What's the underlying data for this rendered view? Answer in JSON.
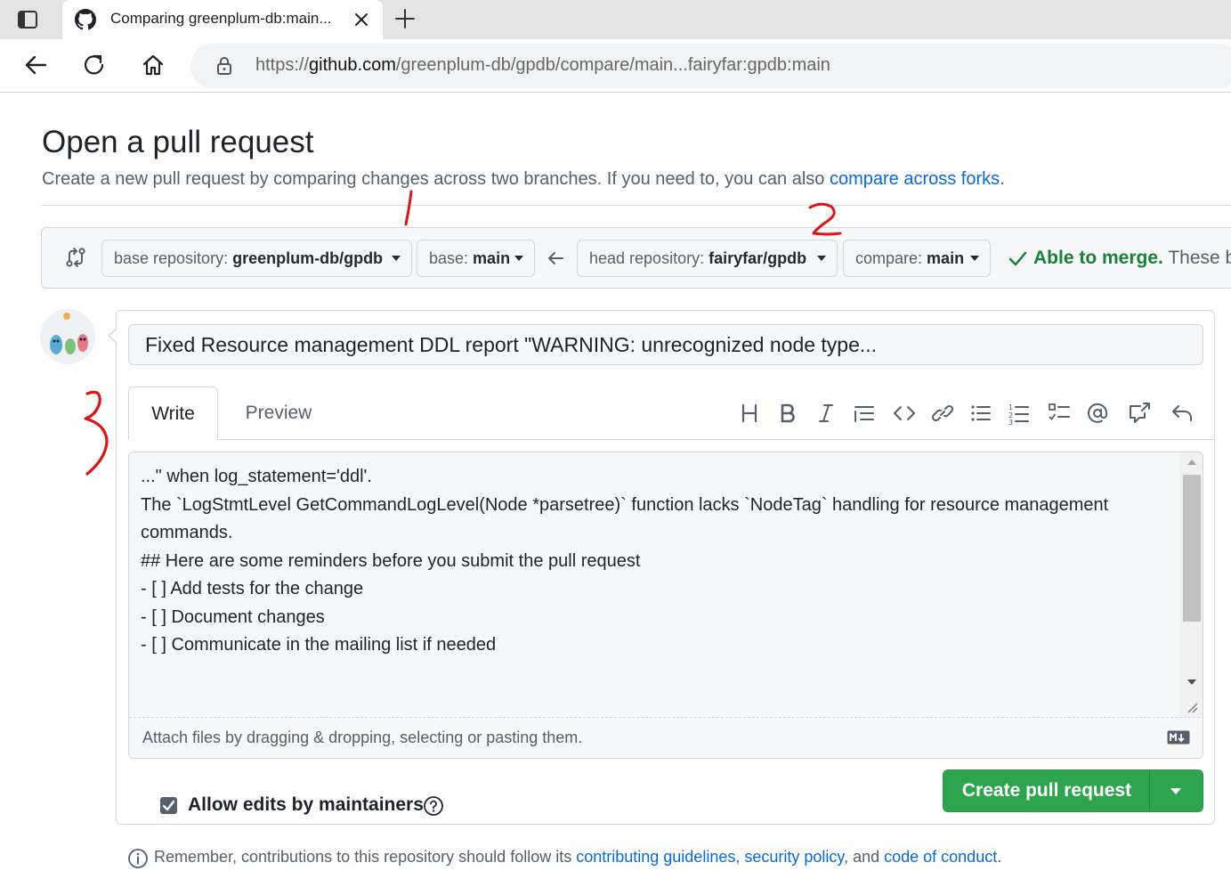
{
  "browser": {
    "tab_title": "Comparing greenplum-db:main...",
    "url_scheme": "https://",
    "url_host": "github.com",
    "url_path": "/greenplum-db/gpdb/compare/main...fairyfar:gpdb:main",
    "icons": [
      "sidebar-icon",
      "github-icon",
      "close-icon",
      "plus-icon",
      "back-arrow-icon",
      "reload-icon",
      "home-icon",
      "lock-icon"
    ]
  },
  "page": {
    "title": "Open a pull request",
    "subtitle_text": "Create a new pull request by comparing changes across two branches. If you need to, you can also ",
    "subtitle_link": "compare across forks",
    "subtitle_end": "."
  },
  "range": {
    "base_repo_label": "base repository: ",
    "base_repo_value": "greenplum-db/gpdb",
    "base_label": "base: ",
    "base_value": "main",
    "head_repo_label": "head repository: ",
    "head_repo_value": "fairyfar/gpdb",
    "compare_label": "compare: ",
    "compare_value": "main",
    "merge_ok": "Able to merge.",
    "merge_rest": " These br"
  },
  "form": {
    "title_value": "Fixed Resource management DDL report \"WARNING: unrecognized node type...",
    "tab_write": "Write",
    "tab_preview": "Preview",
    "body_lines": [
      "...\" when log_statement='ddl'.",
      "",
      "The `LogStmtLevel GetCommandLogLevel(Node *parsetree)` function lacks `NodeTag` handling for resource management",
      "commands.",
      "",
      "## Here are some reminders before you submit the pull request",
      "- [ ] Add tests for the change",
      "- [ ] Document changes",
      "- [ ] Communicate in the mailing list if needed"
    ],
    "attach_text": "Attach files by dragging & dropping, selecting or pasting them.",
    "allow_edits_label": "Allow edits by maintainers",
    "allow_edits_checked": true,
    "create_button": "Create pull request",
    "accent_color": "#2da44e"
  },
  "footer": {
    "prefix": "Remember, contributions to this repository should follow its ",
    "link1": "contributing guidelines",
    "sep1": ", ",
    "link2": "security policy",
    "sep2": ", and ",
    "link3": "code of conduct",
    "end": "."
  },
  "annotations": [
    "1",
    "2",
    "3"
  ]
}
